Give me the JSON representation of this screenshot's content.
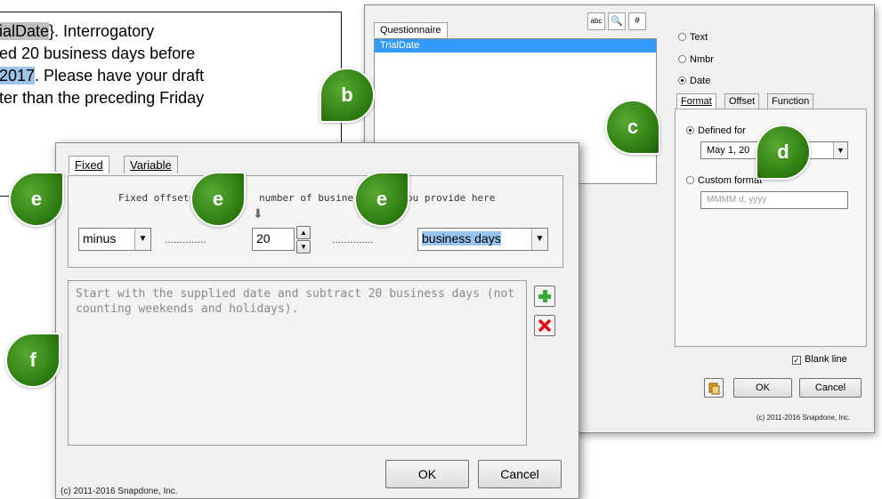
{
  "document": {
    "lines": [
      {
        "pre_hl": "ialDate",
        "text": "}. Interrogatory"
      },
      {
        "text": "ed 20 business days before"
      },
      {
        "hl": "2017",
        "text": ". Please have your draft"
      },
      {
        "text": "ter than the preceding Friday"
      }
    ]
  },
  "right_dialog": {
    "tab": "Questionnaire",
    "toolbar": [
      "abc",
      "🔍",
      "#"
    ],
    "list_items": [
      "TrialDate"
    ],
    "type_options": [
      "Text",
      "Nmbr",
      "Date"
    ],
    "selected_type": "Date",
    "subtabs": [
      "Format",
      "Offset",
      "Function"
    ],
    "active_subtab": "Format",
    "defined_format_label": "Defined for",
    "defined_format_value": "May 1, 20",
    "custom_format_label": "Custom format",
    "custom_format_placeholder": "MMMM d, yyyy",
    "blank_line_label": "Blank line",
    "ok_label": "OK",
    "cancel_label": "Cancel",
    "copyright": "(c) 2011-2016 Snapdone, Inc."
  },
  "front_dialog": {
    "tabs": [
      "Fixed",
      "Variable"
    ],
    "active_tab": "Fixed",
    "hint_left": "Fixed offsets",
    "hint_mid": "number of busines",
    "hint_right": "ou provide here",
    "direction_value": "minus",
    "dots": "..............",
    "number_value": "20",
    "unit_value": "business days",
    "description": "Start with the supplied date and subtract 20 business days (not counting weekends and holidays).",
    "ok_label": "OK",
    "cancel_label": "Cancel",
    "copyright": "(c) 2011-2016 Snapdone, Inc."
  },
  "callouts": [
    "b",
    "c",
    "d",
    "e",
    "e",
    "e",
    "f"
  ],
  "colors": {
    "accent": "#3399ff",
    "callout": "#3a8a18",
    "add": "#3aa83a",
    "remove": "#e01010"
  }
}
